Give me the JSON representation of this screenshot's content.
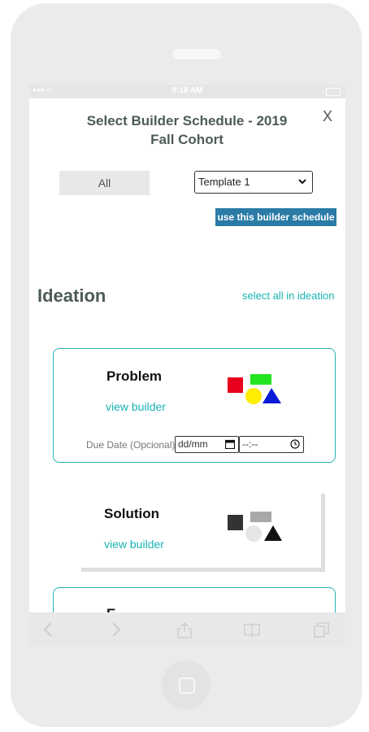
{
  "status_bar": {
    "signal": "●●●○○",
    "time": "9:18 AM"
  },
  "modal": {
    "title_line1": "Select Builder Schedule - 2019",
    "title_line2": "Fall Cohort",
    "close_label": "X"
  },
  "filters": {
    "all_label": "All",
    "template_selected": "Template 1",
    "use_button_label": "use this builder schedule"
  },
  "section": {
    "title": "Ideation",
    "select_all_label": "select all in ideation"
  },
  "builders": [
    {
      "name": "Problem",
      "link": "view builder",
      "due_label": "Due Date (Opcional)",
      "date_placeholder": "dd/mm",
      "time_placeholder": "--:--",
      "icon_colors": [
        "#e8001c",
        "#22e51f",
        "#ffee00",
        "#0a1bd6"
      ]
    },
    {
      "name": "Solution",
      "link": "view builder",
      "icon_colors": [
        "#333333",
        "#a8a8a8",
        "#e6e6e6",
        "#111111"
      ]
    },
    {
      "name": "E..."
    }
  ],
  "colors": {
    "accent": "#19b3b3",
    "primary_button": "#2a7ba6",
    "heading": "#4d5b57"
  }
}
